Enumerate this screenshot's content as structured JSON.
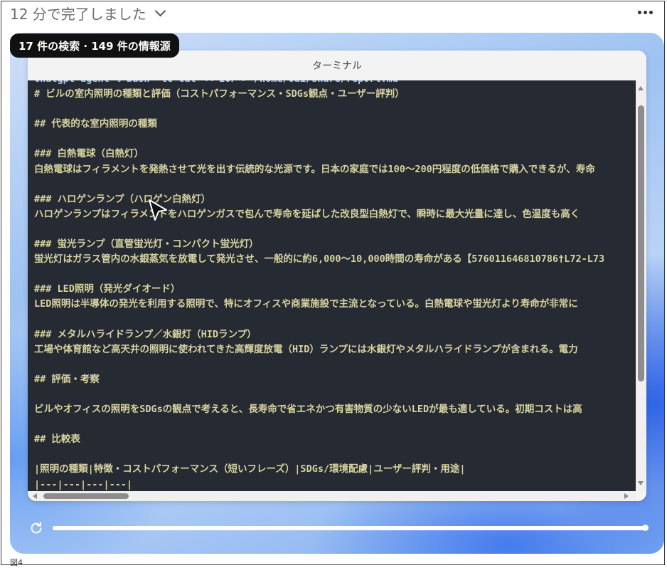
{
  "header": {
    "title": "12 分で完了しました"
  },
  "badge": {
    "text": "17 件の検索 · 149 件の情報源"
  },
  "terminal": {
    "title": "ターミナル",
    "lines": [
      "chatgpt-agent % bash -lc cat << EOF > /home/oai/share/report.md",
      "# ビルの室内照明の種類と評価（コストパフォーマンス・SDGs観点・ユーザー評判）",
      "",
      "## 代表的な室内照明の種類",
      "",
      "### 白熱電球（白熱灯）",
      "白熱電球はフィラメントを発熱させて光を出す伝統的な光源です。日本の家庭では100～200円程度の低価格で購入できるが、寿命",
      "",
      "### ハロゲンランプ（ハロゲン白熱灯）",
      "ハロゲンランプはフィラメントをハロゲンガスで包んで寿命を延ばした改良型白熱灯で、瞬時に最大光量に達し、色温度も高く",
      "",
      "### 蛍光ランプ（直管蛍光灯・コンパクト蛍光灯）",
      "蛍光灯はガラス管内の水銀蒸気を放電して発光させ、一般的に約6,000～10,000時間の寿命がある【576011646810786†L72-L73",
      "",
      "### LED照明（発光ダイオード）",
      "LED照明は半導体の発光を利用する照明で、特にオフィスや商業施設で主流となっている。白熱電球や蛍光灯より寿命が非常に",
      "",
      "### メタルハライドランプ／水銀灯（HIDランプ）",
      "工場や体育館など高天井の照明に使われてきた高輝度放電（HID）ランプには水銀灯やメタルハライドランプが含まれる。電力",
      "",
      "## 評価・考察",
      "",
      "ビルやオフィスの照明をSDGsの観点で考えると、長寿命で省エネかつ有害物質の少ないLEDが最も適している。初期コストは高",
      "",
      "## 比較表",
      "",
      "|照明の種類|特徴・コストパフォーマンス（短いフレーズ）|SDGs/環境配慮|ユーザー評判・用途|",
      "|---|---|---|---|"
    ]
  },
  "player": {
    "progress": 1.0
  },
  "caption": "図4",
  "icons": {
    "more": "more-icon",
    "chevron": "chevron-down-icon",
    "replay": "replay-icon",
    "cursor": "mouse-cursor-icon"
  }
}
